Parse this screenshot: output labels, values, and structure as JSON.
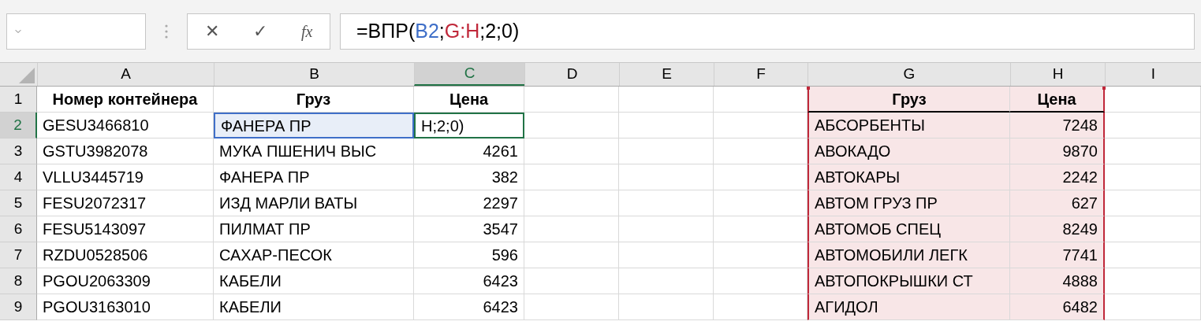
{
  "formula_bar": {
    "cancel_label": "✕",
    "enter_label": "✓",
    "function_label": "fx",
    "formula": [
      {
        "text": "=ВПР(",
        "color": "#000000"
      },
      {
        "text": "B2",
        "color": "#3f6fc8"
      },
      {
        "text": ";",
        "color": "#000000"
      },
      {
        "text": "G:H",
        "color": "#c0283a"
      },
      {
        "text": ";2;0)",
        "color": "#000000"
      }
    ]
  },
  "columns": [
    {
      "label": "A",
      "selected": false,
      "kind": "text"
    },
    {
      "label": "B",
      "selected": false,
      "kind": "text"
    },
    {
      "label": "C",
      "selected": true,
      "kind": "number"
    },
    {
      "label": "D",
      "selected": false,
      "kind": "text"
    },
    {
      "label": "E",
      "selected": false,
      "kind": "text"
    },
    {
      "label": "F",
      "selected": false,
      "kind": "text"
    },
    {
      "label": "G",
      "selected": false,
      "kind": "text",
      "color": "#c0283a"
    },
    {
      "label": "H",
      "selected": false,
      "kind": "number",
      "color": "#c0283a"
    },
    {
      "label": "I",
      "selected": false,
      "kind": "text"
    }
  ],
  "rows": [
    {
      "header": "1",
      "selected": false,
      "kind": "header",
      "cells": {
        "A": {
          "text": "Номер контейнера"
        },
        "B": {
          "text": "Груз"
        },
        "C": {
          "text": "Цена"
        },
        "G": {
          "text": "Груз"
        },
        "H": {
          "text": "Цена"
        }
      }
    },
    {
      "header": "2",
      "selected": true,
      "kind": "data",
      "cells": {
        "A": {
          "text": "GESU3466810"
        },
        "B": {
          "text": "ФАНЕРА ПР",
          "color": "#3f6fc8"
        },
        "C": {
          "text": "H;2;0)",
          "editing": true
        },
        "G": {
          "text": "АБСОРБЕНТЫ"
        },
        "H": {
          "text": "7248"
        }
      }
    },
    {
      "header": "3",
      "selected": false,
      "kind": "data",
      "cells": {
        "A": {
          "text": "GSTU3982078"
        },
        "B": {
          "text": "МУКА ПШЕНИЧ ВЫС"
        },
        "C": {
          "text": "4261"
        },
        "G": {
          "text": "АВОКАДО"
        },
        "H": {
          "text": "9870"
        }
      }
    },
    {
      "header": "4",
      "selected": false,
      "kind": "data",
      "cells": {
        "A": {
          "text": "VLLU3445719"
        },
        "B": {
          "text": "ФАНЕРА ПР"
        },
        "C": {
          "text": "382"
        },
        "G": {
          "text": "АВТОКАРЫ"
        },
        "H": {
          "text": "2242"
        }
      }
    },
    {
      "header": "5",
      "selected": false,
      "kind": "data",
      "cells": {
        "A": {
          "text": "FESU2072317"
        },
        "B": {
          "text": "ИЗД МАРЛИ ВАТЫ"
        },
        "C": {
          "text": "2297"
        },
        "G": {
          "text": "АВТОМ ГРУЗ ПР"
        },
        "H": {
          "text": "627"
        }
      }
    },
    {
      "header": "6",
      "selected": false,
      "kind": "data",
      "cells": {
        "A": {
          "text": "FESU5143097"
        },
        "B": {
          "text": "ПИЛМАТ ПР"
        },
        "C": {
          "text": "3547"
        },
        "G": {
          "text": "АВТОМОБ СПЕЦ"
        },
        "H": {
          "text": "8249"
        }
      }
    },
    {
      "header": "7",
      "selected": false,
      "kind": "data",
      "cells": {
        "A": {
          "text": "RZDU0528506"
        },
        "B": {
          "text": "САХАР-ПЕСОК"
        },
        "C": {
          "text": "596"
        },
        "G": {
          "text": "АВТОМОБИЛИ ЛЕГК"
        },
        "H": {
          "text": "7741"
        }
      }
    },
    {
      "header": "8",
      "selected": false,
      "kind": "data",
      "cells": {
        "A": {
          "text": "PGOU2063309"
        },
        "B": {
          "text": "КАБЕЛИ"
        },
        "C": {
          "text": "6423"
        },
        "G": {
          "text": "АВТОПОКРЫШКИ СТ"
        },
        "H": {
          "text": "4888"
        }
      }
    },
    {
      "header": "9",
      "selected": false,
      "kind": "data",
      "cells": {
        "A": {
          "text": "PGOU3163010"
        },
        "B": {
          "text": "КАБЕЛИ"
        },
        "C": {
          "text": "6423"
        },
        "G": {
          "text": "АГИДОЛ"
        },
        "H": {
          "text": "6482"
        }
      }
    }
  ]
}
